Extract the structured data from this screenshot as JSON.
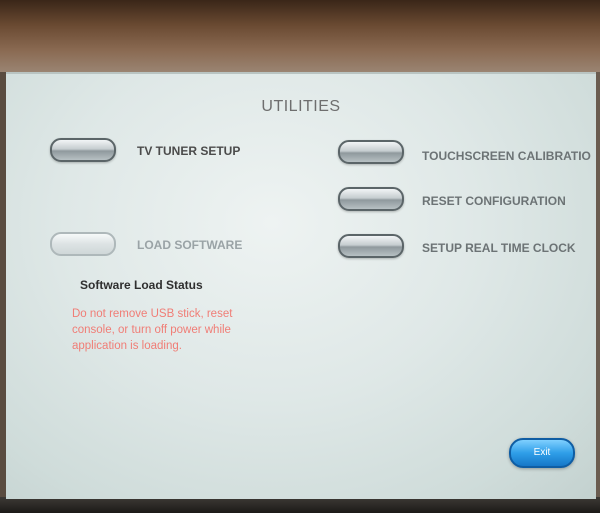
{
  "screen": {
    "title": "UTILITIES"
  },
  "buttons": {
    "tv_tuner_setup": {
      "label": "TV TUNER SETUP",
      "enabled": true
    },
    "load_software": {
      "label": "LOAD SOFTWARE",
      "enabled": false
    },
    "touchscreen_calibration": {
      "label": "TOUCHSCREEN CALIBRATIO",
      "enabled": true
    },
    "reset_configuration": {
      "label": "RESET CONFIGURATION",
      "enabled": true
    },
    "setup_real_time_clock": {
      "label": "SETUP REAL TIME CLOCK",
      "enabled": true
    },
    "exit": {
      "label": "Exit"
    }
  },
  "software_load": {
    "status_heading": "Software Load Status",
    "warning": "Do not remove USB stick, reset console, or turn off power while application is loading."
  },
  "colors": {
    "warning_text": "#f07d76",
    "exit_button": "#2f9ee8",
    "screen_background": "#dfe8e7"
  }
}
